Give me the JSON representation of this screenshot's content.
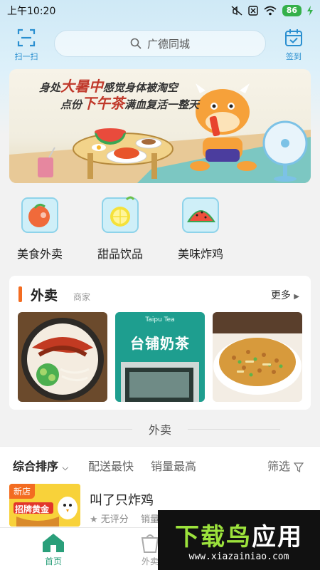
{
  "status_bar": {
    "time": "上午10:20",
    "battery": "86"
  },
  "header": {
    "scan_label": "扫一扫",
    "search_placeholder": "广德同城",
    "sign_label": "签到",
    "accent_color": "#2a8fd0"
  },
  "banner": {
    "line1_pre": "身处",
    "line1_big": "大暑中",
    "line1_post": "感觉身体被淘空",
    "line2_pre": "点份",
    "line2_big": "下午茶",
    "line2_post": "满血复活一整天"
  },
  "categories": [
    {
      "label": "美食外卖",
      "icon": "food-delivery-icon"
    },
    {
      "label": "甜品饮品",
      "icon": "lemon-drink-icon"
    },
    {
      "label": "美味炸鸡",
      "icon": "watermelon-icon"
    }
  ],
  "takeaway_card": {
    "title": "外卖",
    "subtitle": "商家",
    "more_label": "更多",
    "shops": [
      {
        "image": "noodle-photo"
      },
      {
        "image": "milk-tea-shop-photo",
        "sign_text": "台铺奶茶",
        "sign_top": "Taipu Tea"
      },
      {
        "image": "fried-rice-photo"
      }
    ]
  },
  "section_label": "外卖",
  "sort_bar": {
    "items": [
      "综合排序",
      "配送最快",
      "销量最高"
    ],
    "filter_label": "筛选"
  },
  "shop_list": [
    {
      "badge": "新店",
      "thumb_text": "招牌黄金",
      "name": "叫了只炸鸡",
      "rating": "无评分",
      "sales": "销量"
    }
  ],
  "bottom_nav": {
    "items": [
      {
        "label": "首页",
        "active": true
      },
      {
        "label": "外卖",
        "active": false
      }
    ],
    "active_color": "#2a9f7a"
  },
  "watermark": {
    "title_green": "下载鸟",
    "title_white": "应用",
    "url": "www.xiazainiao.com"
  }
}
